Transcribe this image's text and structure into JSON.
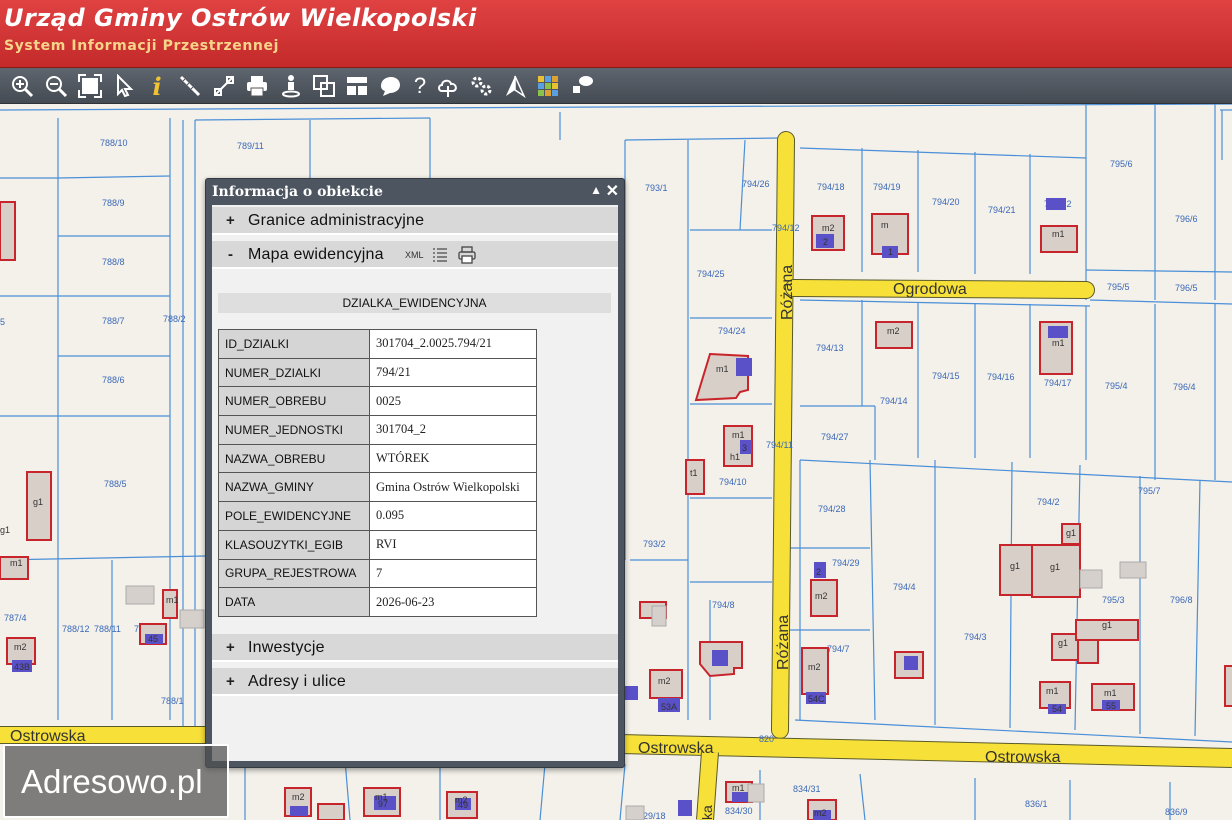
{
  "header": {
    "title": "Urząd Gminy Ostrów Wielkopolski",
    "subtitle": "System Informacji Przestrzennej",
    "bg_color": "#d33434",
    "subtitle_color": "#f6d58a"
  },
  "toolbar": {
    "tools": [
      "zoom-in-icon",
      "zoom-out-icon",
      "zoom-extent-icon",
      "select-pointer-icon",
      "info-icon",
      "measure-distance-icon",
      "measure-area-icon",
      "print-icon",
      "street-view-icon",
      "copy-icon",
      "layout-icon",
      "comment-icon",
      "help-icon",
      "upload-cloud-icon",
      "settings-icon",
      "north-arrow-icon",
      "layers-icon",
      "chat-icon"
    ],
    "info_label": "i",
    "help_label": "?"
  },
  "map": {
    "streets": [
      {
        "name": "Różana"
      },
      {
        "name": "Ogrodowa"
      },
      {
        "name": "Ostrowska"
      }
    ],
    "street_labels": [
      "Różana",
      "Różana",
      "Ogrodowa",
      "Ostrowska",
      "Ostrowska",
      "Ostrowska",
      "ka"
    ],
    "parcel_labels": [
      "788/10",
      "789/11",
      "788/9",
      "788/8",
      "788/7",
      "788/2",
      "788/6",
      "788/5",
      "787/4",
      "788/12",
      "788/11",
      "788/3",
      "788/1",
      "793/1",
      "794/26",
      "794/18",
      "794/19",
      "794/20",
      "794/21",
      "794/22",
      "795/6",
      "796/6",
      "794/12",
      "794/25",
      "795/5",
      "796/5",
      "794/24",
      "794/13",
      "794/15",
      "794/16",
      "794/17",
      "795/4",
      "796/4",
      "794/14",
      "794/27",
      "794/11",
      "794/10",
      "794/28",
      "794/2",
      "795/7",
      "793/2",
      "794/29",
      "794/4",
      "794/8",
      "795/3",
      "796/8",
      "794/7",
      "794/3",
      "820",
      "834/31",
      "836/1",
      "836/9",
      "834/30",
      "829/18",
      "5"
    ],
    "building_labels": [
      "g1",
      "g1",
      "m2",
      "2",
      "m",
      "1",
      "m1",
      "m2",
      "1",
      "m1",
      "m1",
      "m1",
      "h1",
      "t1",
      "g1",
      "g1",
      "g1",
      "g1",
      "g1",
      "m2",
      "m2",
      "m2",
      "m1",
      "m1",
      "m2",
      "m2",
      "m1",
      "m1",
      "m2",
      "m2",
      "m1",
      "m1",
      "1",
      "2",
      "3"
    ],
    "address_numbers": [
      "53A",
      "54C",
      "54",
      "55",
      "43B",
      "45",
      "97",
      "49"
    ],
    "parcel_line_color": "#4a8fd8",
    "street_color": "#f7e038",
    "building_outline_color": "#c8242c"
  },
  "info_panel": {
    "title": "Informacja o obiekcie",
    "collapse_label": "▲",
    "close_label": "✕",
    "sections": [
      {
        "sign": "+",
        "label": "Granice administracyjne"
      },
      {
        "sign": "-",
        "label": "Mapa ewidencyjna"
      },
      {
        "sign": "+",
        "label": "Inwestycje"
      },
      {
        "sign": "+",
        "label": "Adresy i ulice"
      }
    ],
    "xml_label": "XML",
    "layer_name": "DZIALKA_EWIDENCYJNA",
    "attributes": [
      {
        "key": "ID_DZIALKI",
        "value": "301704_2.0025.794/21"
      },
      {
        "key": "NUMER_DZIALKI",
        "value": "794/21"
      },
      {
        "key": "NUMER_OBREBU",
        "value": "0025"
      },
      {
        "key": "NUMER_JEDNOSTKI",
        "value": "301704_2"
      },
      {
        "key": "NAZWA_OBREBU",
        "value": "WTÓREK"
      },
      {
        "key": "NAZWA_GMINY",
        "value": "Gmina Ostrów Wielkopolski"
      },
      {
        "key": "POLE_EWIDENCYJNE",
        "value": "0.095"
      },
      {
        "key": "KLASOUZYTKI_EGIB",
        "value": "RVI"
      },
      {
        "key": "GRUPA_REJESTROWA",
        "value": "7"
      },
      {
        "key": "DATA",
        "value": "2026-06-23"
      }
    ]
  },
  "watermark": {
    "text": "Adresowo.pl"
  }
}
